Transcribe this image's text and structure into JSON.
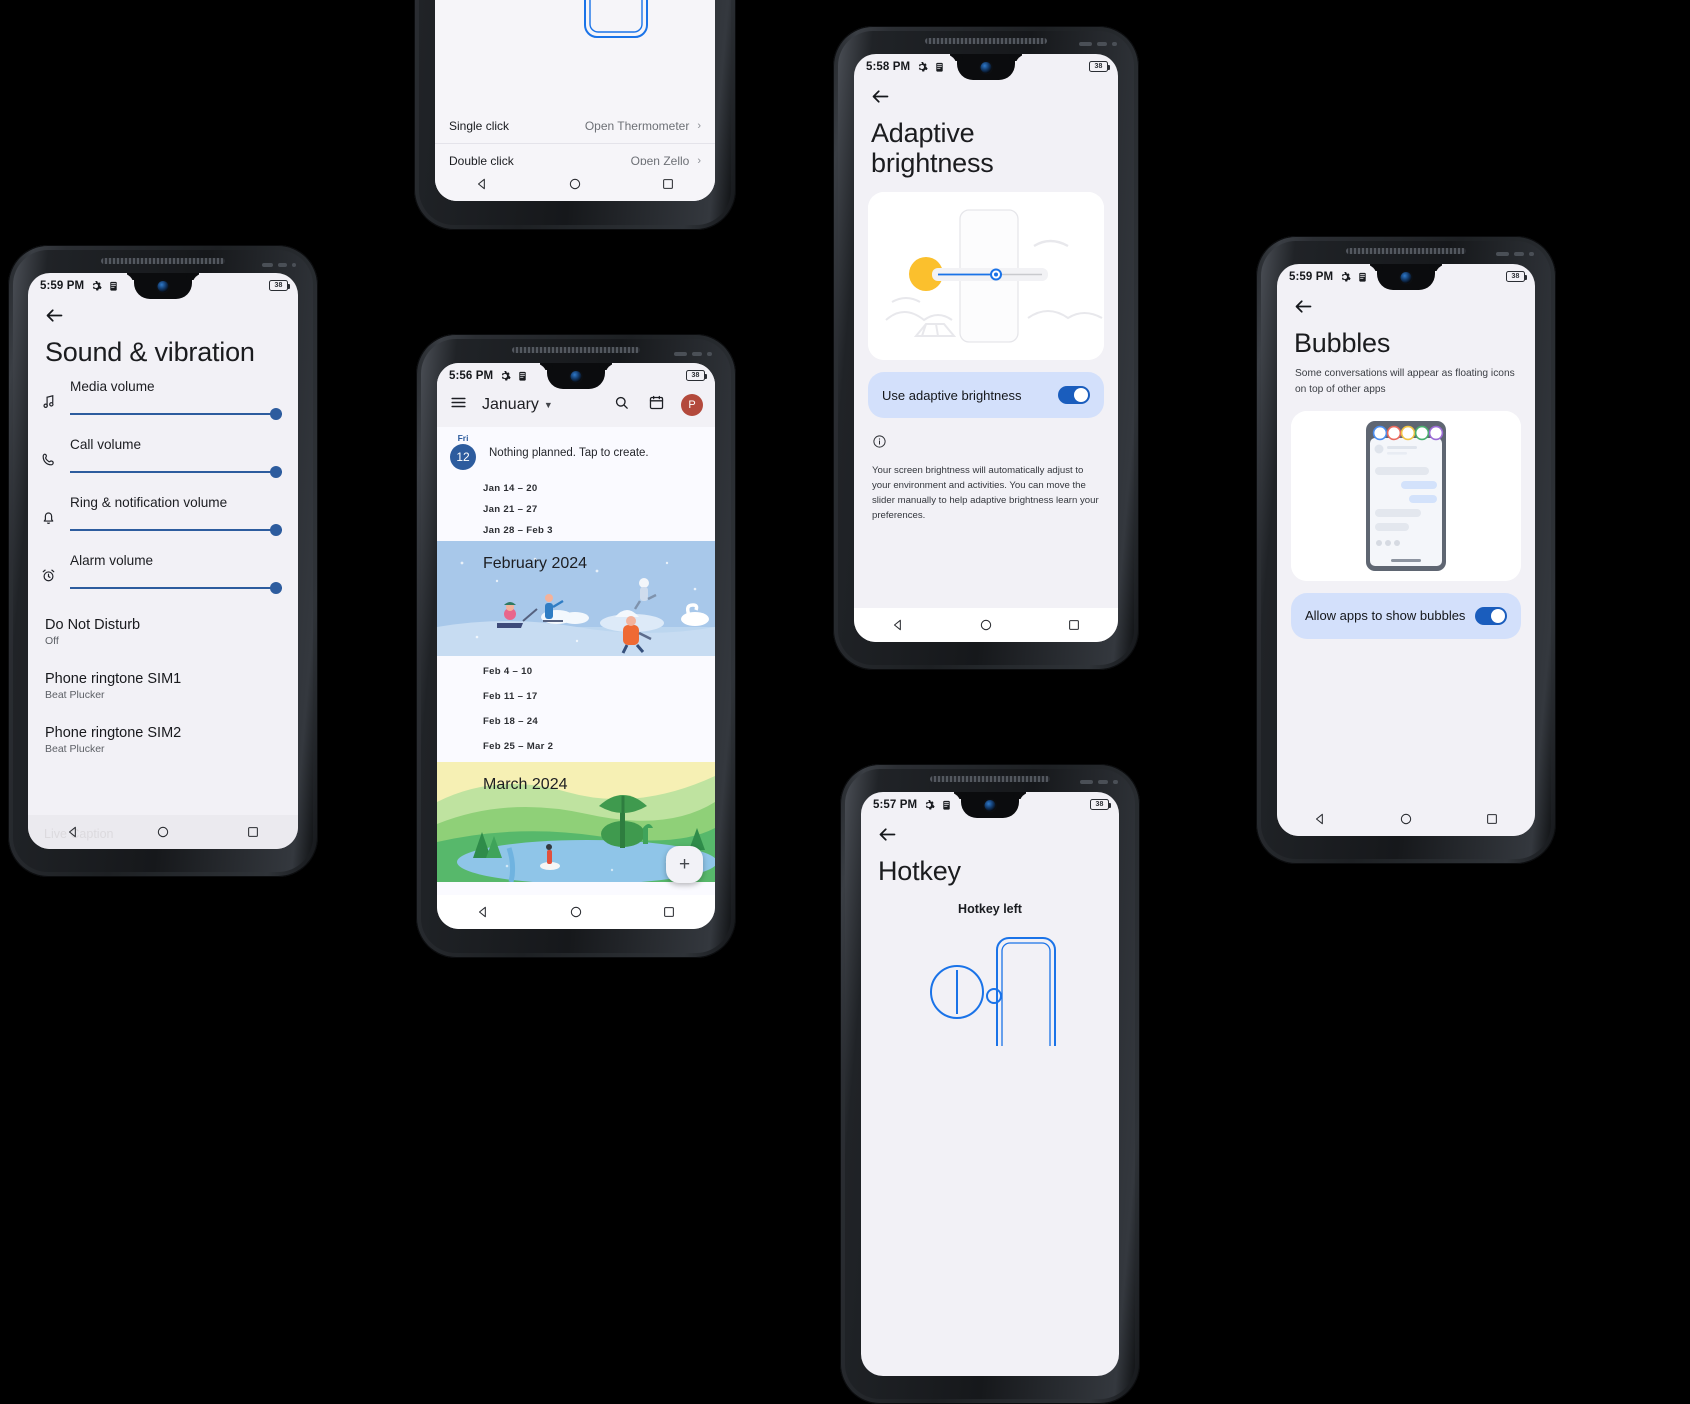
{
  "phones": {
    "sound": {
      "status": {
        "time": "5:59 PM",
        "battery": "38"
      },
      "title": "Sound & vibration",
      "sliders": [
        {
          "label": "Media volume",
          "icon": "music-note-icon",
          "value": 100
        },
        {
          "label": "Call volume",
          "icon": "phone-icon",
          "value": 100
        },
        {
          "label": "Ring & notification volume",
          "icon": "bell-icon",
          "value": 100
        },
        {
          "label": "Alarm volume",
          "icon": "alarm-clock-icon",
          "value": 100
        }
      ],
      "items": [
        {
          "title": "Do Not Disturb",
          "subtitle": "Off"
        },
        {
          "title": "Phone ringtone SIM1",
          "subtitle": "Beat Plucker"
        },
        {
          "title": "Phone ringtone SIM2",
          "subtitle": "Beat Plucker"
        }
      ],
      "partial_item": "Live Caption"
    },
    "calendar": {
      "status": {
        "time": "5:56 PM",
        "battery": "38"
      },
      "month": "January",
      "avatar_initial": "P",
      "today": {
        "dow": "Fri",
        "day": "12",
        "message": "Nothing planned. Tap to create."
      },
      "january_weeks": [
        "Jan 14 – 20",
        "Jan 21 – 27",
        "Jan 28 – Feb 3"
      ],
      "february_banner": "February 2024",
      "february_weeks": [
        "Feb 4 – 10",
        "Feb 11 – 17",
        "Feb 18 – 24",
        "Feb 25 – Mar 2"
      ],
      "march_banner": "March 2024",
      "fab_label": "+"
    },
    "brightness": {
      "status": {
        "time": "5:58 PM",
        "battery": "38"
      },
      "title": "Adaptive brightness",
      "toggle_label": "Use adaptive brightness",
      "toggle_on": true,
      "info": "Your screen brightness will automatically adjust to your environment and activities. You can move the slider manually to help adaptive brightness learn your preferences."
    },
    "bubbles": {
      "status": {
        "time": "5:59 PM",
        "battery": "38"
      },
      "title": "Bubbles",
      "subtitle": "Some conversations will appear as floating icons on top of other apps",
      "toggle_label": "Allow apps to show bubbles",
      "toggle_on": true
    },
    "hotkey_top": {
      "rows": [
        {
          "label": "Single click",
          "value": "Open Thermometer"
        },
        {
          "label": "Double click",
          "value": "Open Zello"
        }
      ]
    },
    "hotkey_bottom": {
      "status": {
        "time": "5:57 PM",
        "battery": "38"
      },
      "title": "Hotkey",
      "section": "Hotkey left"
    }
  },
  "colors": {
    "accent_blue": "#2d5c9e",
    "tile_blue": "#d3e0fb",
    "toggle_blue": "#1a5dbd",
    "screen_bg": "#f2f1f6",
    "page_bg": "#000000"
  }
}
